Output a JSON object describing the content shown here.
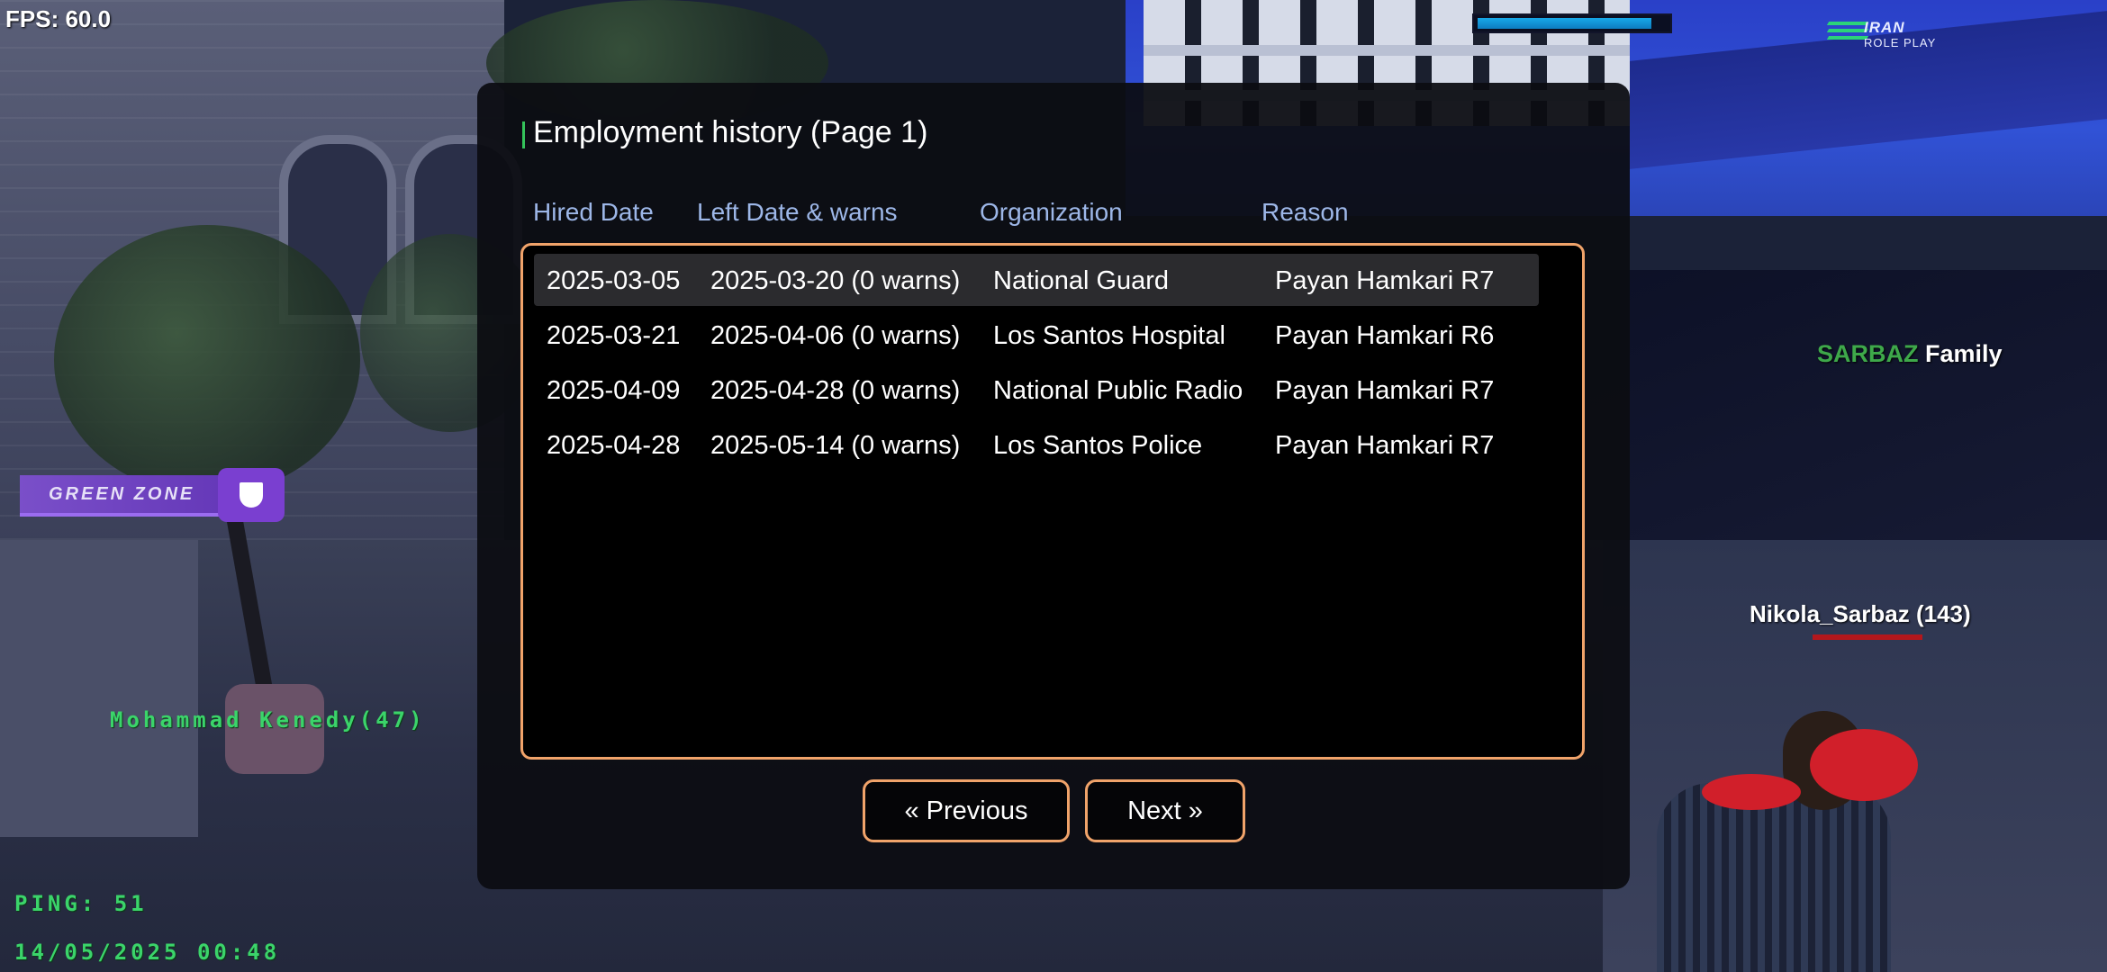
{
  "hud": {
    "fps": "FPS: 60.0",
    "health_fraction": 0.92,
    "logo_title": "IRAN",
    "logo_subtitle": "ROLE PLAY",
    "zone_label": "GREEN ZONE",
    "ping": "PING: 51",
    "datetime": "14/05/2025 00:48",
    "npc_name": "Mohammad Kenedy(47)"
  },
  "family_tag": {
    "name": "SARBAZ",
    "word": "Family",
    "name_color": "#3ea84a"
  },
  "player": {
    "name": "Nikola_Sarbaz (143)"
  },
  "dialog": {
    "title": "Employment history (Page 1)",
    "columns": [
      "Hired Date",
      "Left Date & warns",
      "Organization",
      "Reason"
    ],
    "rows": [
      [
        "2025-03-05",
        "2025-03-20 (0 warns)",
        "National Guard",
        "Payan Hamkari R7"
      ],
      [
        "2025-03-21",
        "2025-04-06 (0 warns)",
        "Los Santos Hospital",
        "Payan Hamkari R6"
      ],
      [
        "2025-04-09",
        "2025-04-28 (0 warns)",
        "National Public Radio",
        "Payan Hamkari R7"
      ],
      [
        "2025-04-28",
        "2025-05-14 (0 warns)",
        "Los Santos Police",
        "Payan Hamkari R7"
      ]
    ],
    "selected_row": 0,
    "prev_label": "« Previous",
    "next_label": "Next »",
    "accent_color": "#f0a36a"
  }
}
